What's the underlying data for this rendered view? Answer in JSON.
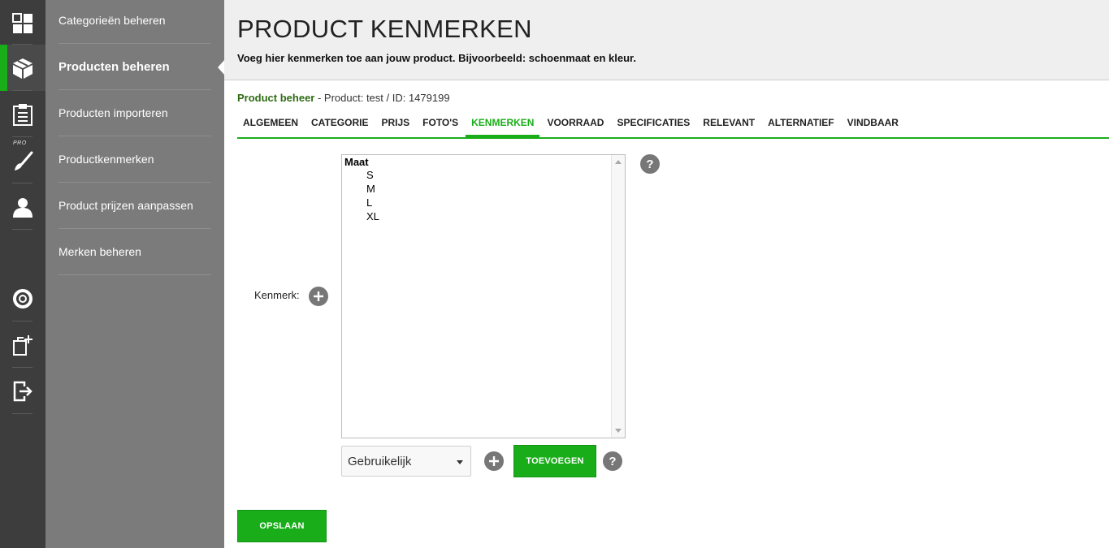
{
  "rail": {
    "items": [
      {
        "name": "dashboard-icon"
      },
      {
        "name": "box-icon",
        "active": true
      },
      {
        "name": "clipboard-icon"
      },
      {
        "name": "brush-icon",
        "badge": "PRO"
      },
      {
        "name": "user-icon"
      },
      {
        "name": "lifebuoy-icon"
      },
      {
        "name": "copy-add-icon"
      },
      {
        "name": "logout-icon"
      }
    ]
  },
  "submenu": {
    "items": [
      {
        "label": "Categorieën beheren"
      },
      {
        "label": "Producten beheren",
        "active": true
      },
      {
        "label": "Producten importeren"
      },
      {
        "label": "Productkenmerken"
      },
      {
        "label": "Product prijzen aanpassen"
      },
      {
        "label": "Merken beheren"
      }
    ]
  },
  "header": {
    "title": "PRODUCT KENMERKEN",
    "subtitle": "Voeg hier kenmerken toe aan jouw product. Bijvoorbeeld: schoenmaat en kleur."
  },
  "breadcrumb": {
    "link": "Product beheer",
    "rest": " - Product: test / ID: 1479199"
  },
  "tabs": [
    {
      "label": "ALGEMEEN"
    },
    {
      "label": "CATEGORIE"
    },
    {
      "label": "PRIJS"
    },
    {
      "label": "FOTO'S"
    },
    {
      "label": "KENMERKEN",
      "active": true
    },
    {
      "label": "VOORRAAD"
    },
    {
      "label": "SPECIFICATIES"
    },
    {
      "label": "RELEVANT"
    },
    {
      "label": "ALTERNATIEF"
    },
    {
      "label": "VINDBAAR"
    }
  ],
  "form": {
    "kenmerk_label": "Kenmerk:",
    "help_symbol": "?",
    "list": {
      "group": "Maat",
      "options": [
        "S",
        "M",
        "L",
        "XL"
      ]
    },
    "select": {
      "value": "Gebruikelijk"
    },
    "add_button": "TOEVOEGEN",
    "save_button": "OPSLAAN"
  },
  "colors": {
    "accent": "#1aad1a",
    "rail_bg": "#3d3d3d",
    "submenu_bg": "#7b7b7b",
    "header_bg": "#efefef",
    "breadcrumb_link": "#2f6b14"
  }
}
